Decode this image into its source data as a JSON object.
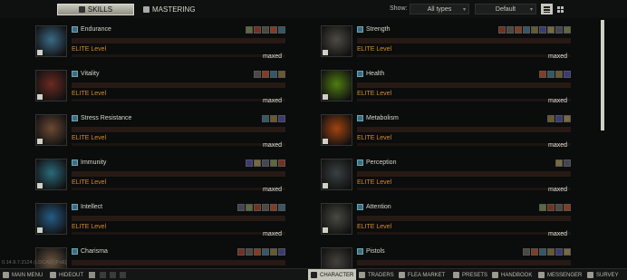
{
  "topbar": {
    "tab_skills": "SKILLS",
    "tab_mastering": "MASTERING",
    "show_label": "Show:",
    "filter_value": "All types",
    "sort_value": "Default"
  },
  "skills": [
    {
      "name": "Endurance",
      "level": "ELITE Level",
      "status": "maxed",
      "color": "#3b6a86",
      "buffs": 5
    },
    {
      "name": "Strength",
      "level": "ELITE Level",
      "status": "maxed",
      "color": "#4d4b42",
      "buffs": 9
    },
    {
      "name": "Vitality",
      "level": "ELITE Level",
      "status": "maxed",
      "color": "#6a2a20",
      "buffs": 4
    },
    {
      "name": "Health",
      "level": "ELITE Level",
      "status": "maxed",
      "color": "#4f7d10",
      "buffs": 4
    },
    {
      "name": "Stress Resistance",
      "level": "ELITE Level",
      "status": "maxed",
      "color": "#6b4a33",
      "buffs": 3
    },
    {
      "name": "Metabolism",
      "level": "ELITE Level",
      "status": "maxed",
      "color": "#a3440e",
      "buffs": 3
    },
    {
      "name": "Immunity",
      "level": "ELITE Level",
      "status": "maxed",
      "color": "#2a6a7a",
      "buffs": 5
    },
    {
      "name": "Perception",
      "level": "ELITE Level",
      "status": "maxed",
      "color": "#3a4040",
      "buffs": 2
    },
    {
      "name": "Intellect",
      "level": "ELITE Level",
      "status": "maxed",
      "color": "#245d86",
      "buffs": 6
    },
    {
      "name": "Attention",
      "level": "ELITE Level",
      "status": "maxed",
      "color": "#4a4a42",
      "buffs": 4
    },
    {
      "name": "Charisma",
      "level": "",
      "status": "",
      "color": "#6b5540",
      "buffs": 6
    },
    {
      "name": "Pistols",
      "level": "",
      "status": "",
      "color": "#45423d",
      "buffs": 6
    }
  ],
  "version": "0.14.9.7.3124 (LOCAL) [PvE]",
  "bottombar": {
    "main_menu": "MAIN MENU",
    "hideout": "HIDEOUT",
    "character": "CHARACTER",
    "traders": "TRADERS",
    "flea_market": "FLEA MARKET",
    "presets": "PRESETS",
    "handbook": "HANDBOOK",
    "messenger": "MESSENGER",
    "survey": "SURVEY"
  }
}
